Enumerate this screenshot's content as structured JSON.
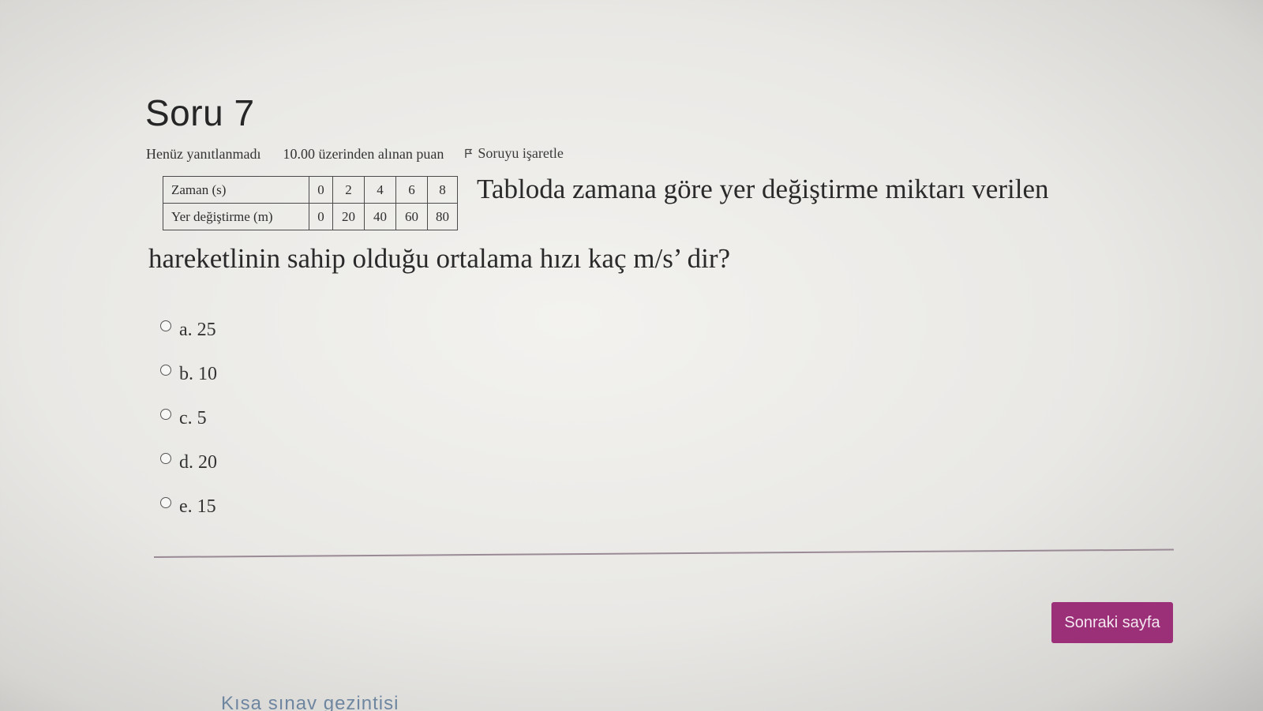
{
  "question": {
    "title": "Soru 7",
    "status": "Henüz yanıtlanmadı",
    "grade_info": "10.00 üzerinden alınan puan",
    "flag_label": "Soruyu işaretle",
    "text_line1": "Tabloda zamana göre yer değiştirme miktarı verilen",
    "text_line2": "hareketlinin sahip olduğu ortalama hızı kaç m/s’ dir?"
  },
  "table": {
    "rows": [
      {
        "label": "Zaman (s)",
        "values": [
          "0",
          "2",
          "4",
          "6",
          "8"
        ]
      },
      {
        "label": "Yer değiştirme (m)",
        "values": [
          "0",
          "20",
          "40",
          "60",
          "80"
        ]
      }
    ]
  },
  "answers": [
    {
      "letter": "a.",
      "value": "25"
    },
    {
      "letter": "b.",
      "value": "10"
    },
    {
      "letter": "c.",
      "value": "5"
    },
    {
      "letter": "d.",
      "value": "20"
    },
    {
      "letter": "e.",
      "value": "15"
    }
  ],
  "footer": {
    "next_button": "Sonraki sayfa",
    "quiz_nav": "Kısa sınav gezintisi"
  },
  "colors": {
    "button_bg": "#9b2f78",
    "divider": "#9a8a95"
  },
  "icons": {
    "flag": "flag-icon",
    "radio": "radio-unchecked-icon"
  }
}
